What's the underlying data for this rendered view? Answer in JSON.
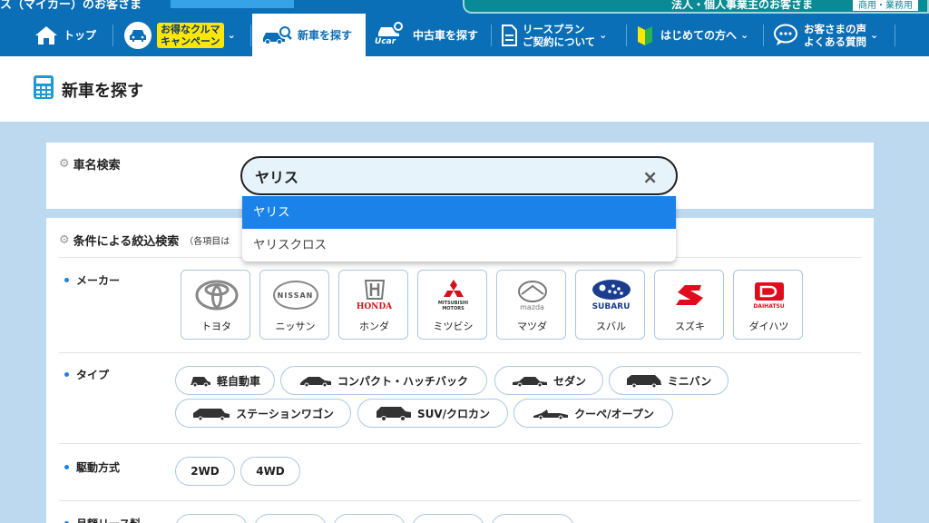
{
  "topbar": {
    "left_text": "ス（マイカー）のお客さま",
    "right_text": "法人・個人事業主のお客さま",
    "right_tag": "商用・業務用"
  },
  "nav": {
    "top": "トップ",
    "campaign_line1": "お得なクルマ",
    "campaign_line2": "キャンペーン",
    "new_car": "新車を探す",
    "used_car": "中古車を探す",
    "used_badge": "Ucar",
    "lease_line1": "リースプラン",
    "lease_line2": "ご契約について",
    "first_time": "はじめての方へ",
    "voice_line1": "お客さまの声",
    "voice_line2": "よくある質問"
  },
  "page": {
    "title": "新車を探す"
  },
  "name_search": {
    "label": "車名検索",
    "value": "ヤリス",
    "clear_icon": "×",
    "suggestions": [
      "ヤリス",
      "ヤリスクロス"
    ]
  },
  "filter": {
    "label": "条件による絞込検索",
    "note": "（各項目は",
    "maker_label": "メーカー",
    "makers": [
      {
        "name": "トヨタ",
        "logo_text": ""
      },
      {
        "name": "ニッサン",
        "logo_text": "NISSAN"
      },
      {
        "name": "ホンダ",
        "logo_text": "HONDA"
      },
      {
        "name": "ミツビシ",
        "logo_text": "MITSUBISHI MOTORS"
      },
      {
        "name": "マツダ",
        "logo_text": "mazda"
      },
      {
        "name": "スバル",
        "logo_text": "SUBARU"
      },
      {
        "name": "スズキ",
        "logo_text": ""
      },
      {
        "name": "ダイハツ",
        "logo_text": "DAIHATSU"
      }
    ],
    "type_label": "タイプ",
    "types": [
      "軽自動車",
      "コンパクト・ハッチバック",
      "セダン",
      "ミニバン",
      "ステーションワゴン",
      "SUV/クロカン",
      "クーペ/オープン"
    ],
    "drive_label": "駆動方式",
    "drives": [
      "2WD",
      "4WD"
    ],
    "fee_label": "月額リース料"
  },
  "colors": {
    "primary": "#0a6fb7",
    "accent": "#1a82e8",
    "promo": "#ffe600",
    "corporate": "#0a8a94"
  }
}
